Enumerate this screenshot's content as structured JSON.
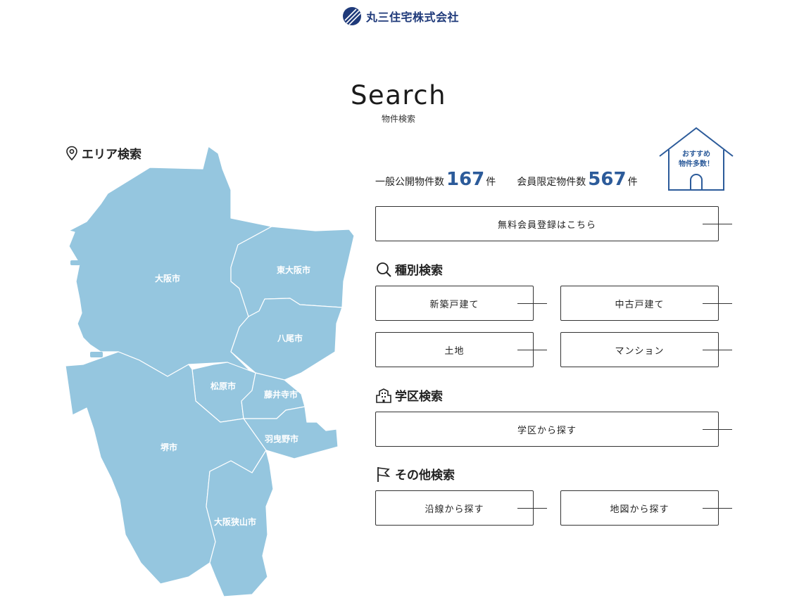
{
  "brand": {
    "name": "丸三住宅株式会社",
    "color": "#1f3a7a"
  },
  "hero": {
    "title": "Search",
    "subtitle": "物件検索"
  },
  "area": {
    "heading": "エリア検索",
    "icon": "map-pin-icon",
    "map_color": "#95c6df",
    "cities": [
      "大阪市",
      "東大阪市",
      "八尾市",
      "松原市",
      "藤井寺市",
      "堺市",
      "羽曳野市",
      "大阪狭山市"
    ]
  },
  "counts": {
    "public_label": "一般公開物件数",
    "public_value": "167",
    "member_label": "会員限定物件数",
    "member_value": "567",
    "unit": "件",
    "accent": "#2c5b9a"
  },
  "badge": {
    "line1": "おすすめ",
    "line2": "物件多数！"
  },
  "register_button": "無料会員登録はこちら",
  "type_search": {
    "heading": "種別検索",
    "icon": "search-icon",
    "buttons": [
      "新築戸建て",
      "中古戸建て",
      "土地",
      "マンション"
    ]
  },
  "school_search": {
    "heading": "学区検索",
    "icon": "school-building-icon",
    "button": "学区から探す"
  },
  "other_search": {
    "heading": "その他検索",
    "icon": "flag-icon",
    "buttons": [
      "沿線から探す",
      "地図から探す"
    ]
  }
}
